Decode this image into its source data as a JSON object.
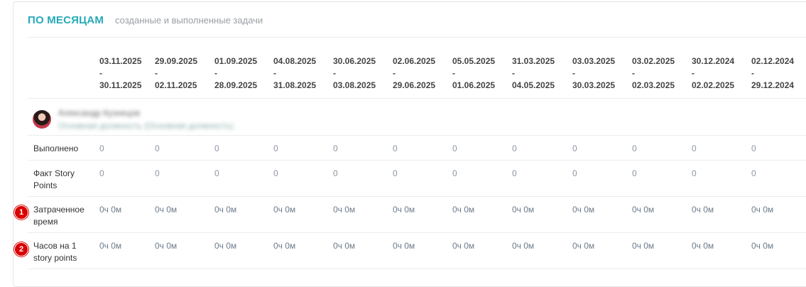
{
  "section": {
    "title": "ПО МЕСЯЦАМ",
    "subtitle": "созданные и выполненные задачи"
  },
  "columns": [
    {
      "start": "03.11.2025",
      "sep": "-",
      "end": "30.11.2025"
    },
    {
      "start": "29.09.2025",
      "sep": "-",
      "end": "02.11.2025"
    },
    {
      "start": "01.09.2025",
      "sep": "-",
      "end": "28.09.2025"
    },
    {
      "start": "04.08.2025",
      "sep": "-",
      "end": "31.08.2025"
    },
    {
      "start": "30.06.2025",
      "sep": "-",
      "end": "03.08.2025"
    },
    {
      "start": "02.06.2025",
      "sep": "-",
      "end": "29.06.2025"
    },
    {
      "start": "05.05.2025",
      "sep": "-",
      "end": "01.06.2025"
    },
    {
      "start": "31.03.2025",
      "sep": "-",
      "end": "04.05.2025"
    },
    {
      "start": "03.03.2025",
      "sep": "-",
      "end": "30.03.2025"
    },
    {
      "start": "03.02.2025",
      "sep": "-",
      "end": "02.03.2025"
    },
    {
      "start": "30.12.2024",
      "sep": "-",
      "end": "02.02.2025"
    },
    {
      "start": "02.12.2024",
      "sep": "-",
      "end": "29.12.2024"
    }
  ],
  "user": {
    "name": "Александр Кузнецов",
    "description": "Основная должность (Основная должность)"
  },
  "rows": [
    {
      "label_lines": [
        "Выполнено"
      ],
      "values": [
        "0",
        "0",
        "0",
        "0",
        "0",
        "0",
        "0",
        "0",
        "0",
        "0",
        "0",
        "0"
      ]
    },
    {
      "label_lines": [
        "Факт Story",
        "Points"
      ],
      "values": [
        "0",
        "0",
        "0",
        "0",
        "0",
        "0",
        "0",
        "0",
        "0",
        "0",
        "0",
        "0"
      ]
    },
    {
      "label_lines": [
        "Затраченное",
        "время"
      ],
      "values": [
        "0ч 0м",
        "0ч 0м",
        "0ч 0м",
        "0ч 0м",
        "0ч 0м",
        "0ч 0м",
        "0ч 0м",
        "0ч 0м",
        "0ч 0м",
        "0ч 0м",
        "0ч 0м",
        "0ч 0м"
      ]
    },
    {
      "label_lines": [
        "Часов на 1",
        "story points"
      ],
      "values": [
        "0ч 0м",
        "0ч 0м",
        "0ч 0м",
        "0ч 0м",
        "0ч 0м",
        "0ч 0м",
        "0ч 0м",
        "0ч 0м",
        "0ч 0м",
        "0ч 0м",
        "0ч 0м",
        "0ч 0м"
      ]
    }
  ],
  "markers": [
    "1",
    "2"
  ],
  "colors": {
    "accent": "#26a9b8",
    "marker": "#d90000"
  }
}
